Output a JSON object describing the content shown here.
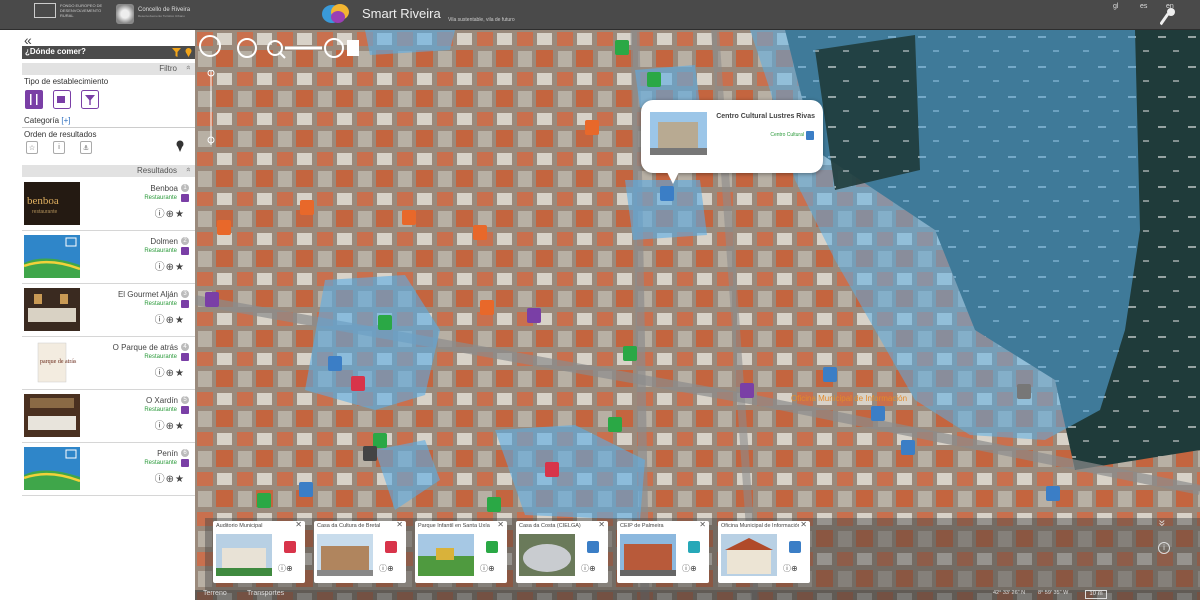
{
  "header": {
    "eu_text": "FONDO EUROPEO DE DESENVOLVEMENTO RURAL",
    "concello_name": "Concello de Riveira",
    "concello_sub": "Desenvolvemento Turístico Urbano",
    "brand_title": "Smart Riveira",
    "brand_tagline": "Vila sustentable, vila de futuro",
    "languages": [
      "gl",
      "es",
      "en"
    ]
  },
  "sidebar": {
    "collapse_symbol": "«",
    "title": "¿Dónde comer?",
    "filter_label": "Filtro",
    "type_label": "Tipo de establecimiento",
    "category_label": "Categoría",
    "category_link": "[+]",
    "order_label": "Orden de resultados",
    "results_label": "Resultados",
    "chevron": "»",
    "type_icons": [
      "restaurant-icon",
      "cafe-icon",
      "bar-icon"
    ],
    "sort_icons": [
      "star-icon",
      "info-icon",
      "anchor-icon"
    ]
  },
  "results": [
    {
      "name": "Benboa",
      "num": "1",
      "type": "Restaurante",
      "thumb_text": "benboa",
      "thumb_sub": "restaurante"
    },
    {
      "name": "Dolmen",
      "num": "2",
      "type": "Restaurante"
    },
    {
      "name": "El Gourmet Alján",
      "num": "3",
      "type": "Restaurante"
    },
    {
      "name": "O Parque de atrás",
      "num": "4",
      "type": "Restaurante",
      "thumb_text": "parque de atrás"
    },
    {
      "name": "O Xardín",
      "num": "5",
      "type": "Restaurante"
    },
    {
      "name": "Penín",
      "num": "6",
      "type": "Restaurante"
    }
  ],
  "result_icons": "ⓘ⊕★",
  "popup": {
    "title": "Centro Cultural Lustres Rivas",
    "type": "Centro Cultural"
  },
  "poi_label": "Oficina Municipal de Información",
  "cards": [
    {
      "title": "Auditorio Municipal",
      "badge_color": "#d8344a"
    },
    {
      "title": "Casa da Cultura de Bretal",
      "badge_color": "#d8344a"
    },
    {
      "title": "Parque Infantil en Santa Uxía",
      "badge_color": "#2aa845"
    },
    {
      "title": "Casa da Costa (CIELGA)",
      "badge_color": "#3b7ec6"
    },
    {
      "title": "CEIP de Palmeira",
      "badge_color": "#26a8b8"
    },
    {
      "title": "Oficina Municipal de Información",
      "badge_color": "#3b7ec6"
    }
  ],
  "card_icons": "ⓘ⊕",
  "card_close": "✕",
  "strip_collapse": "»",
  "strip_info": "i",
  "bottom": {
    "tabs": [
      "Terreno",
      "Transportes"
    ],
    "lat": "42° 33' 26\" N",
    "lon": "8° 59' 35\" W",
    "scale": "10 m"
  },
  "colors": {
    "header_bg": "#4a4a4a",
    "overlay_blue": "#5aaee8",
    "restaurant_purple": "#7a3fa6",
    "culture_red": "#d8344a",
    "park_green": "#2aa845",
    "food_orange": "#e8682a"
  }
}
